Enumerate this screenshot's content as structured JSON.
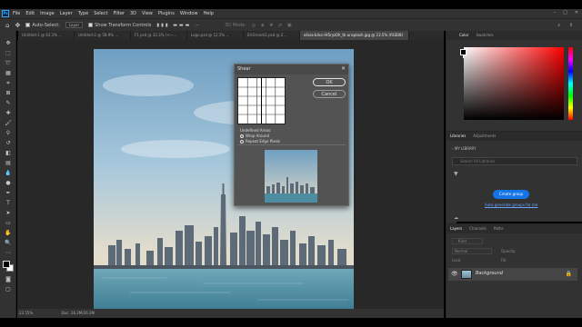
{
  "menu": [
    "File",
    "Edit",
    "Image",
    "Layer",
    "Type",
    "Select",
    "Filter",
    "3D",
    "View",
    "Plugins",
    "Window",
    "Help"
  ],
  "app_logo": "Ps",
  "window_controls": [
    "–",
    "□",
    "✕"
  ],
  "options_bar": {
    "auto_select_label": "Auto-Select:",
    "auto_select_value": "Layer",
    "show_transform_label": "Show Transform Controls",
    "mode_3d": "3D Mode:"
  },
  "tabs": [
    {
      "label": "Untitled-1 @ 63.1% ..."
    },
    {
      "label": "Untitled-2 @ 58.9% ..."
    },
    {
      "label": "F1.psd @ 32.3% (<~..."
    },
    {
      "label": "Logo.psd @ 12.5% ..."
    },
    {
      "label": "Ell-Emedr2.psd @ 2..."
    },
    {
      "label": "olivia-bliss-IH5ryz0h_tk-unsplash.jpg @ 23.5% (RGB/8)"
    }
  ],
  "status": {
    "zoom": "23.55%",
    "doc": "Doc: 26.2M/26.2M"
  },
  "shear_dialog": {
    "title": "Shear",
    "ok_label": "OK",
    "cancel_label": "Cancel",
    "undefined_areas_label": "Undefined Areas:",
    "options": [
      "Wrap Around",
      "Repeat Edge Pixels"
    ],
    "selected_option": "Wrap Around"
  },
  "color_panel": {
    "tabs": [
      "Color",
      "Swatches"
    ],
    "hue_color": "#ff0000"
  },
  "libraries_panel": {
    "tabs": [
      "Libraries",
      "Adjustments"
    ],
    "library_name": "MY LIBRARY",
    "search_placeholder": "Search All Libraries",
    "create_group_label": "Create group",
    "auto_generate_label": "Auto-generate groups for me"
  },
  "layers_panel": {
    "tabs": [
      "Layers",
      "Channels",
      "Paths"
    ],
    "kind_label": "Kind",
    "blend_mode": "Normal",
    "opacity_label": "Opacity:",
    "lock_label": "Lock:",
    "fill_label": "Fill:",
    "layer_name": "Background"
  },
  "colors": {
    "accent": "#1473e6",
    "panel": "#323232",
    "canvas": "#282828"
  }
}
